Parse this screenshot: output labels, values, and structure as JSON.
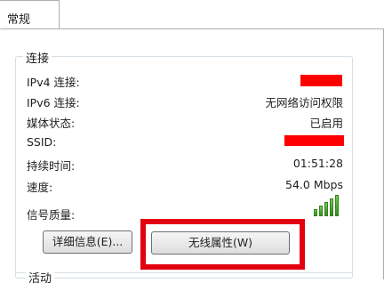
{
  "tabs": [
    {
      "label": "常规"
    }
  ],
  "connection": {
    "title": "连接",
    "rows": [
      {
        "label": "IPv4 连接:",
        "value": ""
      },
      {
        "label": "IPv6 连接:",
        "value": "无网络访问权限"
      },
      {
        "label": "媒体状态:",
        "value": "已启用"
      },
      {
        "label": "SSID:",
        "value": ""
      },
      {
        "label": "持续时间:",
        "value": "01:51:28"
      },
      {
        "label": "速度:",
        "value": "54.0 Mbps"
      },
      {
        "label": "信号质量:",
        "value": ""
      }
    ],
    "signal_level": 5
  },
  "buttons": {
    "details": "详细信息(E)...",
    "wireless_properties": "无线属性(W)"
  },
  "activity": {
    "title": "活动"
  },
  "colors": {
    "redaction": "#ff0000",
    "highlight": "#e3000f",
    "signal": "#3fae22"
  }
}
